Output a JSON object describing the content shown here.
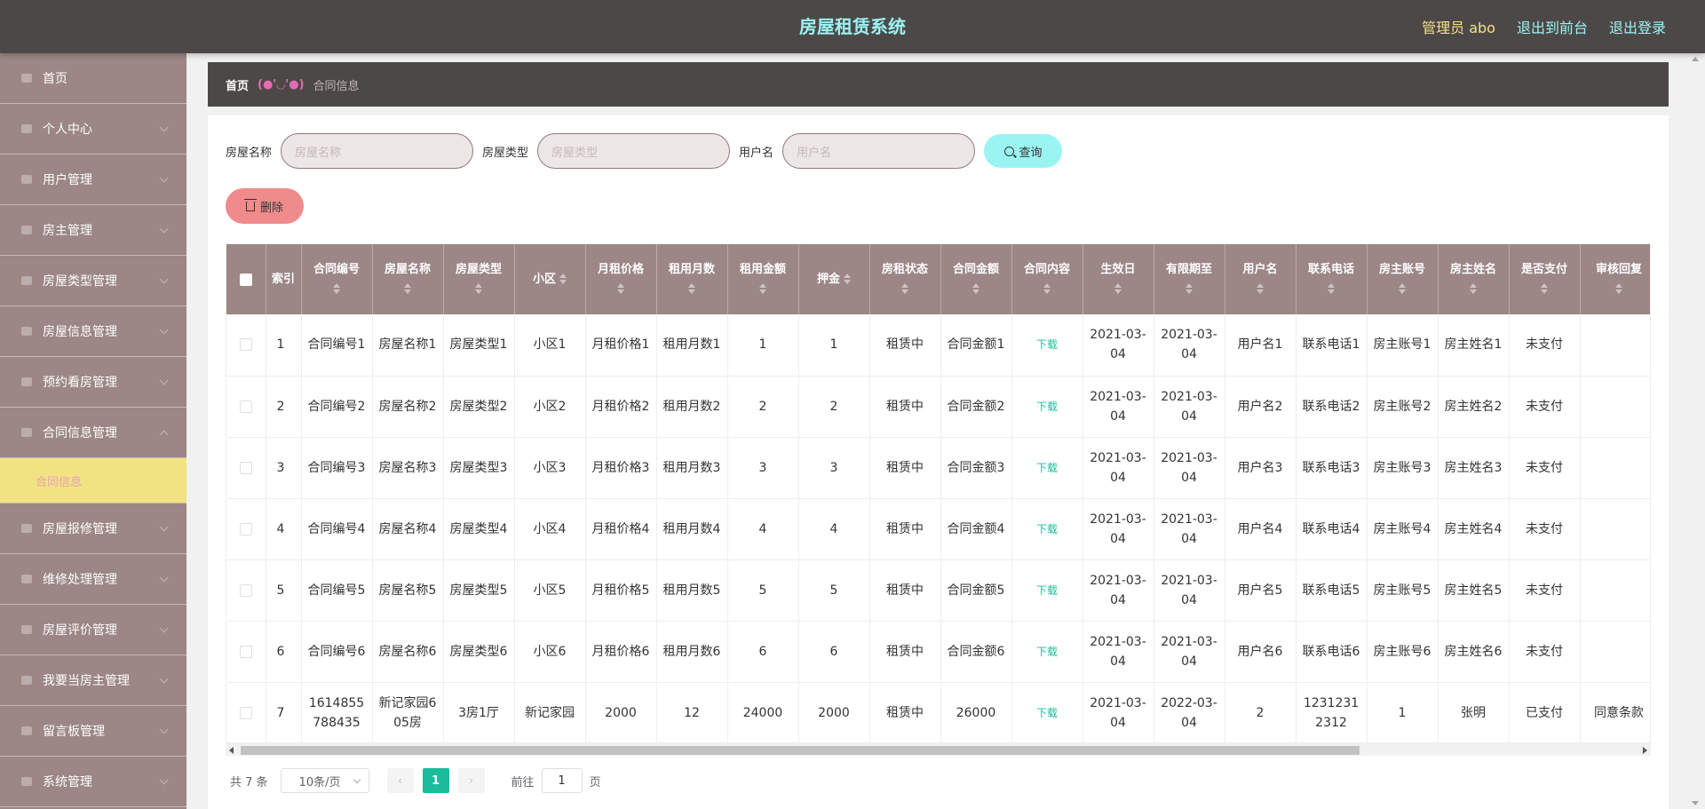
{
  "header": {
    "title": "房屋租赁系统",
    "admin": "管理员 abo",
    "to_front": "退出到前台",
    "logout": "退出登录"
  },
  "sidebar": {
    "items": [
      {
        "label": "首页",
        "icon": "home-icon",
        "chevron": false
      },
      {
        "label": "个人中心",
        "icon": "user-icon",
        "chevron": true
      },
      {
        "label": "用户管理",
        "icon": "user-icon",
        "chevron": true
      },
      {
        "label": "房主管理",
        "icon": "list-icon",
        "chevron": true
      },
      {
        "label": "房屋类型管理",
        "icon": "grid-icon",
        "chevron": true
      },
      {
        "label": "房屋信息管理",
        "icon": "list-icon",
        "chevron": true
      },
      {
        "label": "预约看房管理",
        "icon": "menu-icon",
        "chevron": true
      },
      {
        "label": "合同信息管理",
        "icon": "power-icon",
        "chevron": "up"
      },
      {
        "label": "房屋报修管理",
        "icon": "circle-icon",
        "chevron": true
      },
      {
        "label": "维修处理管理",
        "icon": "tool-icon",
        "chevron": true
      },
      {
        "label": "房屋评价管理",
        "icon": "send-icon",
        "chevron": true
      },
      {
        "label": "我要当房主管理",
        "icon": "clock-icon",
        "chevron": true
      },
      {
        "label": "留言板管理",
        "icon": "message-icon",
        "chevron": true
      },
      {
        "label": "系统管理",
        "icon": "menu-icon",
        "chevron": true
      }
    ],
    "active_sub": "合同信息"
  },
  "breadcrumb": {
    "home": "首页",
    "face": "(●'◡'●)",
    "current": "合同信息"
  },
  "search": {
    "house_name_label": "房屋名称",
    "house_name_placeholder": "房屋名称",
    "house_type_label": "房屋类型",
    "house_type_placeholder": "房屋类型",
    "username_label": "用户名",
    "username_placeholder": "用户名",
    "query_button": "查询"
  },
  "actions": {
    "delete_button": "删除"
  },
  "table": {
    "columns": [
      {
        "label": "",
        "type": "check"
      },
      {
        "label": "索引",
        "sort": false
      },
      {
        "label": "合同编号",
        "sort": true
      },
      {
        "label": "房屋名称",
        "sort": true
      },
      {
        "label": "房屋类型",
        "sort": true
      },
      {
        "label": "小区",
        "sort": true,
        "inline": true
      },
      {
        "label": "月租价格",
        "sort": true
      },
      {
        "label": "租用月数",
        "sort": true
      },
      {
        "label": "租用金额",
        "sort": true
      },
      {
        "label": "押金",
        "sort": true,
        "inline": true
      },
      {
        "label": "房租状态",
        "sort": true
      },
      {
        "label": "合同金额",
        "sort": true
      },
      {
        "label": "合同内容",
        "sort": true
      },
      {
        "label": "生效日",
        "sort": true
      },
      {
        "label": "有限期至",
        "sort": true
      },
      {
        "label": "用户名",
        "sort": true
      },
      {
        "label": "联系电话",
        "sort": true
      },
      {
        "label": "房主账号",
        "sort": true
      },
      {
        "label": "房主姓名",
        "sort": true
      },
      {
        "label": "是否支付",
        "sort": true
      },
      {
        "label": "审核回复",
        "sort": true
      }
    ],
    "rows": [
      [
        "1",
        "合同编号1",
        "房屋名称1",
        "房屋类型1",
        "小区1",
        "月租价格1",
        "租用月数1",
        "1",
        "1",
        "租赁中",
        "合同金额1",
        "下载",
        "2021-03-04",
        "2021-03-04",
        "用户名1",
        "联系电话1",
        "房主账号1",
        "房主姓名1",
        "未支付",
        ""
      ],
      [
        "2",
        "合同编号2",
        "房屋名称2",
        "房屋类型2",
        "小区2",
        "月租价格2",
        "租用月数2",
        "2",
        "2",
        "租赁中",
        "合同金额2",
        "下载",
        "2021-03-04",
        "2021-03-04",
        "用户名2",
        "联系电话2",
        "房主账号2",
        "房主姓名2",
        "未支付",
        ""
      ],
      [
        "3",
        "合同编号3",
        "房屋名称3",
        "房屋类型3",
        "小区3",
        "月租价格3",
        "租用月数3",
        "3",
        "3",
        "租赁中",
        "合同金额3",
        "下载",
        "2021-03-04",
        "2021-03-04",
        "用户名3",
        "联系电话3",
        "房主账号3",
        "房主姓名3",
        "未支付",
        ""
      ],
      [
        "4",
        "合同编号4",
        "房屋名称4",
        "房屋类型4",
        "小区4",
        "月租价格4",
        "租用月数4",
        "4",
        "4",
        "租赁中",
        "合同金额4",
        "下载",
        "2021-03-04",
        "2021-03-04",
        "用户名4",
        "联系电话4",
        "房主账号4",
        "房主姓名4",
        "未支付",
        ""
      ],
      [
        "5",
        "合同编号5",
        "房屋名称5",
        "房屋类型5",
        "小区5",
        "月租价格5",
        "租用月数5",
        "5",
        "5",
        "租赁中",
        "合同金额5",
        "下载",
        "2021-03-04",
        "2021-03-04",
        "用户名5",
        "联系电话5",
        "房主账号5",
        "房主姓名5",
        "未支付",
        ""
      ],
      [
        "6",
        "合同编号6",
        "房屋名称6",
        "房屋类型6",
        "小区6",
        "月租价格6",
        "租用月数6",
        "6",
        "6",
        "租赁中",
        "合同金额6",
        "下载",
        "2021-03-04",
        "2021-03-04",
        "用户名6",
        "联系电话6",
        "房主账号6",
        "房主姓名6",
        "未支付",
        ""
      ],
      [
        "7",
        "1614855788435",
        "新记家园605房",
        "3房1厅",
        "新记家园",
        "2000",
        "12",
        "24000",
        "2000",
        "租赁中",
        "26000",
        "下载",
        "2021-03-04",
        "2022-03-04",
        "2",
        "12312312312",
        "1",
        "张明",
        "已支付",
        "同意条款"
      ]
    ]
  },
  "pager": {
    "total": "共 7 条",
    "page_size": "10条/页",
    "current_page": "1",
    "goto_label": "前往",
    "goto_value": "1",
    "page_suffix": "页"
  },
  "colors": {
    "topbar": "#4d4848",
    "sidebar": "#9c8686",
    "accent_cyan": "#9af4f2",
    "active_sub": "#f1e282",
    "delete": "#f08b8b",
    "page_active": "#1abc9c"
  }
}
